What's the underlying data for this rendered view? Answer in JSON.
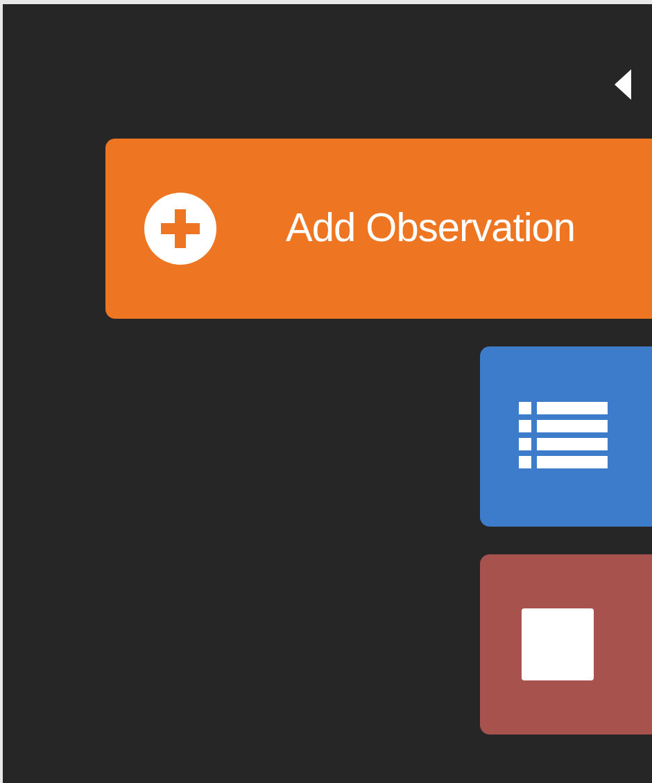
{
  "panel": {
    "add_button": {
      "label": "Add Observation"
    },
    "actions": [
      {
        "kind": "list"
      },
      {
        "kind": "stop"
      }
    ]
  }
}
